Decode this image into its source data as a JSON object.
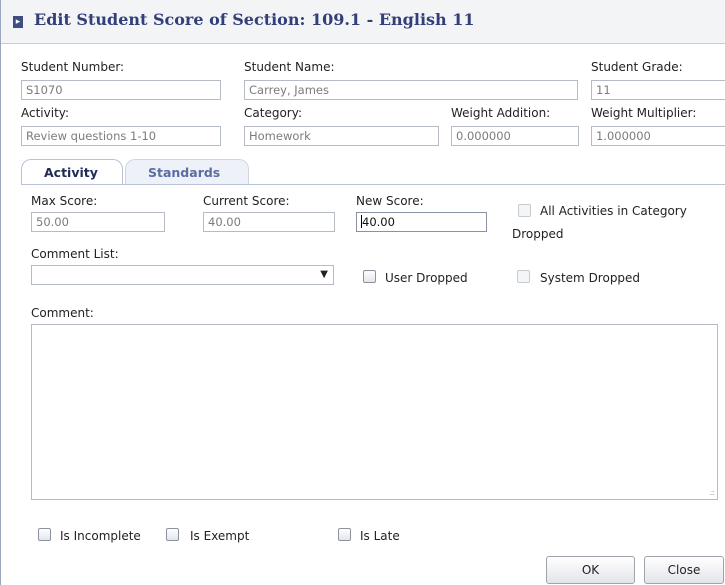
{
  "dialog": {
    "title": "Edit Student Score of Section: 109.1 - English 11"
  },
  "student": {
    "number_label": "Student Number:",
    "number_value": "S1070",
    "name_label": "Student Name:",
    "name_value": "Carrey, James",
    "grade_label": "Student Grade:",
    "grade_value": "11"
  },
  "activity": {
    "activity_label": "Activity:",
    "activity_value": "Review questions 1-10",
    "category_label": "Category:",
    "category_value": "Homework",
    "weight_addition_label": "Weight Addition:",
    "weight_addition_value": "0.000000",
    "weight_multiplier_label": "Weight Multiplier:",
    "weight_multiplier_value": "1.000000"
  },
  "tabs": [
    {
      "label": "Activity",
      "active": true
    },
    {
      "label": "Standards",
      "active": false
    }
  ],
  "scores": {
    "max_label": "Max Score:",
    "max_value": "50.00",
    "current_label": "Current Score:",
    "current_value": "40.00",
    "new_label": "New Score:",
    "new_value": "40.00"
  },
  "checkboxes": {
    "all_activities_line1": "All Activities in Category",
    "all_activities_line2": "Dropped",
    "user_dropped": "User Dropped",
    "system_dropped": "System Dropped",
    "is_incomplete": "Is Incomplete",
    "is_exempt": "Is Exempt",
    "is_late": "Is Late"
  },
  "comment": {
    "list_label": "Comment List:",
    "list_selected": "",
    "comment_label": "Comment:",
    "comment_value": ""
  },
  "buttons": {
    "ok": "OK",
    "close": "Close"
  },
  "colors": {
    "title": "#333f78",
    "tab_active": "#1f2b55",
    "tab_inactive": "#5a6da5"
  }
}
